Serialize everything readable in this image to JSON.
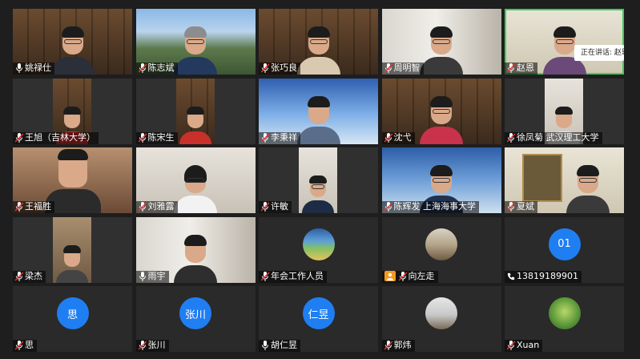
{
  "speaking_tooltip": "正在讲话: 赵恩",
  "participants": [
    {
      "name": "姚禄仕"
    },
    {
      "name": "陈志斌"
    },
    {
      "name": "张巧良"
    },
    {
      "name": "周明智"
    },
    {
      "name": "赵恩"
    },
    {
      "name": "王旭（吉林大学）"
    },
    {
      "name": "陈宋生"
    },
    {
      "name": "李秉祥"
    },
    {
      "name": "沈弋"
    },
    {
      "name": "徐凤菊 武汉理工大学"
    },
    {
      "name": "王福胜"
    },
    {
      "name": "刘雅露"
    },
    {
      "name": "许敏"
    },
    {
      "name": "陈辉发 上海海事大学"
    },
    {
      "name": "夏斌"
    },
    {
      "name": "梁杰"
    },
    {
      "name": "雨宇"
    },
    {
      "name": "年会工作人员"
    },
    {
      "name": "向左走"
    },
    {
      "name": "13819189901"
    },
    {
      "name": "思",
      "avatar_text": "思"
    },
    {
      "name": "张川",
      "avatar_text": "张川"
    },
    {
      "name": "胡仁昱",
      "avatar_text": "仁昱"
    },
    {
      "name": "郭炜"
    },
    {
      "name": "Xuan"
    }
  ],
  "phone_avatar_text": "01",
  "colors": {
    "accent": "#1f7ef2",
    "speaking": "#3ecf5c"
  }
}
